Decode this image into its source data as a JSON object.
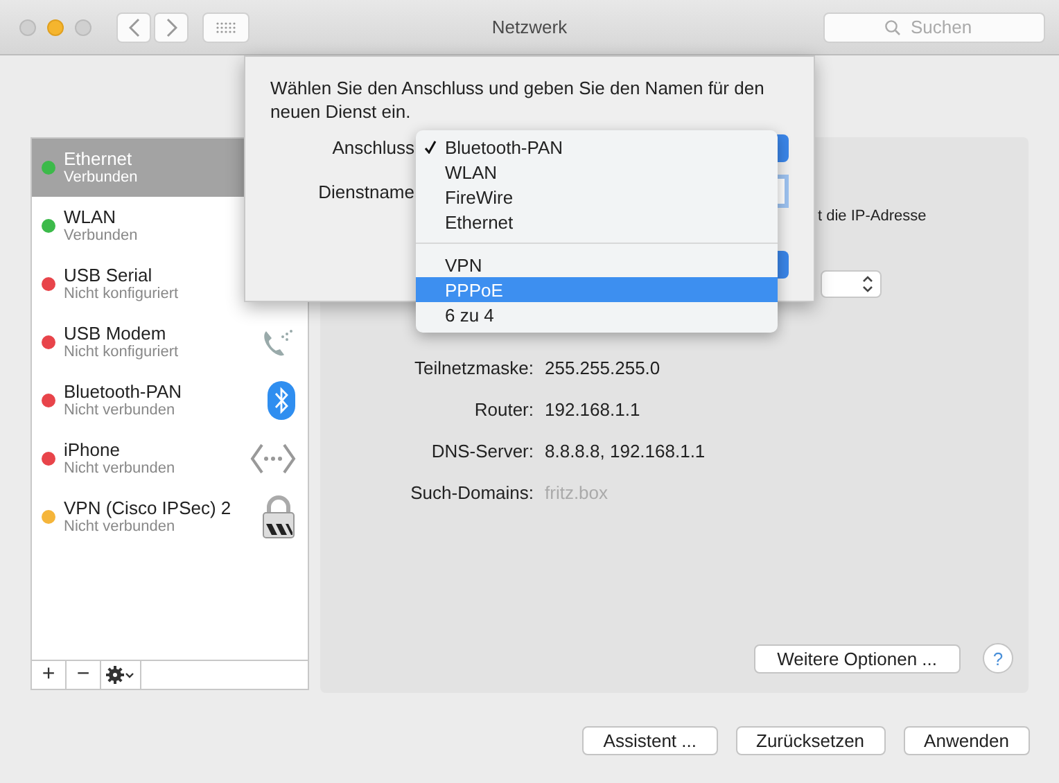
{
  "window": {
    "title": "Netzwerk",
    "search_placeholder": "Suchen"
  },
  "services": [
    {
      "name": "Ethernet",
      "status": "Verbunden",
      "color": "#3cba4a",
      "selected": true
    },
    {
      "name": "WLAN",
      "status": "Verbunden",
      "color": "#3cba4a",
      "selected": false
    },
    {
      "name": "USB Serial",
      "status": "Nicht konfiguriert",
      "color": "#e8444a",
      "selected": false
    },
    {
      "name": "USB Modem",
      "status": "Nicht konfiguriert",
      "color": "#e8444a",
      "selected": false,
      "kind": "phone"
    },
    {
      "name": "Bluetooth-PAN",
      "status": "Nicht verbunden",
      "color": "#e8444a",
      "selected": false,
      "kind": "bluetooth"
    },
    {
      "name": "iPhone",
      "status": "Nicht verbunden",
      "color": "#e8444a",
      "selected": false,
      "kind": "dots"
    },
    {
      "name": "VPN (Cisco IPSec) 2",
      "status": "Nicht verbunden",
      "color": "#f5b53a",
      "selected": false,
      "kind": "lock"
    }
  ],
  "sidebar_toolbar": {
    "add": "+",
    "remove": "−"
  },
  "panel": {
    "partial_text": "t die IP-Adresse",
    "details": [
      {
        "label": "Teilnetzmaske:",
        "value": "255.255.255.0",
        "dim": false
      },
      {
        "label": "Router:",
        "value": "192.168.1.1",
        "dim": false
      },
      {
        "label": "DNS-Server:",
        "value": "8.8.8.8, 192.168.1.1",
        "dim": false
      },
      {
        "label": "Such-Domains:",
        "value": "fritz.box",
        "dim": true
      }
    ],
    "more_button": "Weitere Optionen ...",
    "help": "?"
  },
  "buttons": [
    "Assistent ...",
    "Zurücksetzen",
    "Anwenden"
  ],
  "sheet": {
    "message": "Wählen Sie den Anschluss und geben Sie den Namen für den neuen Dienst ein.",
    "labels": [
      "Anschluss",
      "Dienstname"
    ]
  },
  "menu": {
    "groups": [
      [
        {
          "label": "Bluetooth-PAN",
          "checked": true,
          "selected": false
        },
        {
          "label": "WLAN",
          "checked": false,
          "selected": false
        },
        {
          "label": "FireWire",
          "checked": false,
          "selected": false
        },
        {
          "label": "Ethernet",
          "checked": false,
          "selected": false
        }
      ],
      [
        {
          "label": "VPN",
          "checked": false,
          "selected": false
        },
        {
          "label": "PPPoE",
          "checked": false,
          "selected": true
        },
        {
          "label": "6 zu 4",
          "checked": false,
          "selected": false
        }
      ]
    ]
  }
}
